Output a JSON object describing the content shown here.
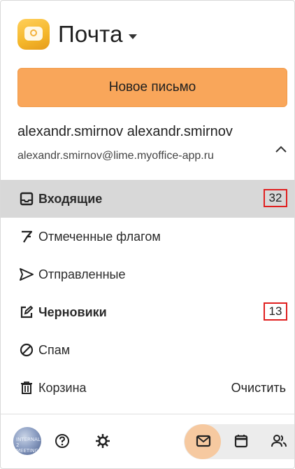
{
  "app": {
    "title": "Почта"
  },
  "compose": {
    "label": "Новое письмо"
  },
  "account": {
    "name": "alexandr.smirnov alexandr.smirnov",
    "email": "alexandr.smirnov@lime.myoffice-app.ru"
  },
  "folders": [
    {
      "label": "Входящие",
      "count": "32",
      "active": true,
      "bold": true,
      "icon": "inbox-icon"
    },
    {
      "label": "Отмеченные флагом",
      "icon": "flag-icon"
    },
    {
      "label": "Отправленные",
      "icon": "send-icon"
    },
    {
      "label": "Черновики",
      "count": "13",
      "bold": true,
      "icon": "drafts-edit-icon"
    },
    {
      "label": "Спам",
      "icon": "spam-icon"
    },
    {
      "label": "Корзина",
      "icon": "trash-icon",
      "action": "Очистить"
    }
  ],
  "bottom": {
    "avatar_text": "INTERNAL 2 MEETING",
    "icons": [
      "avatar",
      "help-icon",
      "settings-icon",
      "mail-icon",
      "calendar-icon",
      "contacts-icon"
    ]
  },
  "colors": {
    "accent": "#f9a65a",
    "active_row": "#d8d8d8",
    "badge_border": "#e02020"
  }
}
